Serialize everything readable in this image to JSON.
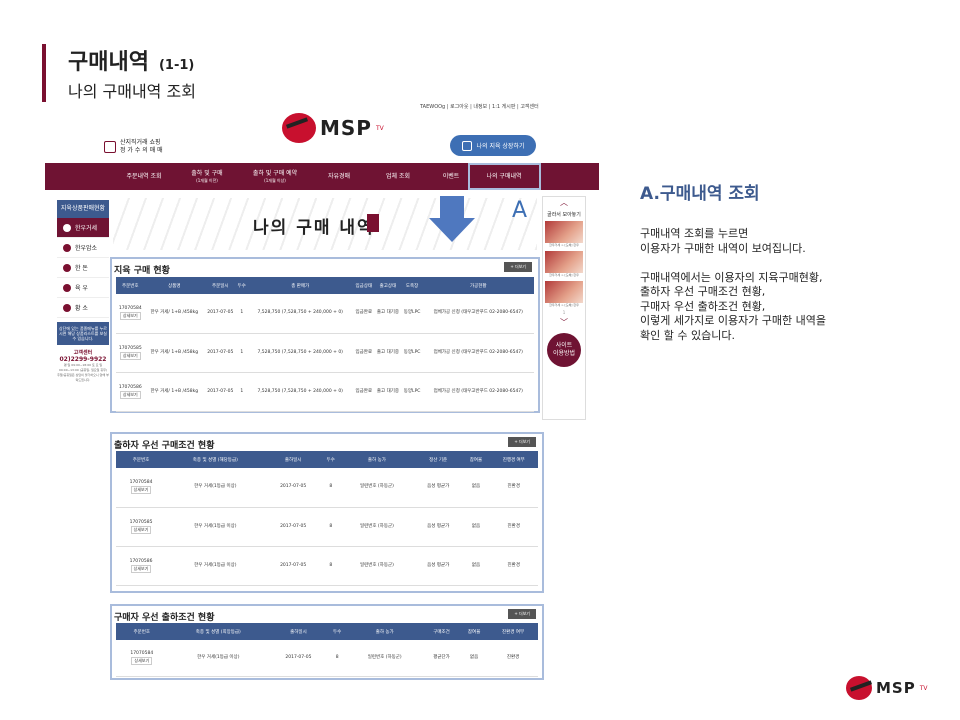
{
  "slide": {
    "title": "구매내역",
    "title_num": "(1-1)",
    "subtitle": "나의 구매내역 조회"
  },
  "site": {
    "util_links": "TAEWOOg | 로그아웃 | 내정보 | 1:1 게시판 | 고객센터",
    "logo_text": "MSP",
    "logo_tv": "TV",
    "cert_line1": "산지직거래 쇼핑",
    "cert_line2": "정 가 수 의 매 매",
    "cart_button": "나의 지육 상장하기",
    "nav": [
      {
        "label": "주문내역 조회",
        "sub": ""
      },
      {
        "label": "출하 및 구매",
        "sub": "(1개월 이전)"
      },
      {
        "label": "출하 및 구매 예약",
        "sub": "(1개월 이상)"
      },
      {
        "label": "자유경매",
        "sub": ""
      },
      {
        "label": "업체 조회",
        "sub": ""
      },
      {
        "label": "이벤트",
        "sub": ""
      },
      {
        "label": "나의 구매내역",
        "sub": ""
      }
    ],
    "banner_title": "나의 구매 내역",
    "marker": "A"
  },
  "left_sidebar": {
    "header": "지육상품판매현황",
    "items": [
      "한우거세",
      "한우암소",
      "한    돈",
      "육    우",
      "황    소"
    ],
    "notice": "상단에 있는 품종메뉴를 누르시면 해당 상품리스트를 보실 수 있습니다.",
    "cs_label": "고객센터",
    "cs_phone": "02)2299-9922",
    "hours": "평 일 09:00~18:00 토 요 일 09:00~13:00 (공휴일, 일요일 휴무)",
    "mini": "주말/공휴일은 상담이 불가하오니 양해 부탁드립니다."
  },
  "right_sidebar": {
    "up": "︿",
    "title": "골라서 모아놓기",
    "items": [
      "한우거세 > [도체] 한우",
      "한우거세 > [도체] 한우",
      "한우거세 > [도체] 한우"
    ],
    "page": "1",
    "down": "﹀",
    "usage": [
      "사이트",
      "이용방법"
    ]
  },
  "tables": {
    "purchase": {
      "title": "지육 구매 현황",
      "more": "+ 더보기",
      "headers": [
        "주문번호",
        "상품명",
        "주문일시",
        "두수",
        "총 판매가",
        "입금상태",
        "출고상태",
        "도축장",
        "가공현황"
      ],
      "rows": [
        [
          "17070584",
          "한우 거세/ 1+B /458kg",
          "2017-07-05",
          "1",
          "7,528,750 (7,528,750 + 240,000 + 0)",
          "입금완료",
          "출고 대기중",
          "동양LPC",
          "업체가공 신청 (태우고반푸드 02-2080-6547)"
        ],
        [
          "17070585",
          "한우 거세/ 1+B /458kg",
          "2017-07-05",
          "1",
          "7,528,750 (7,528,750 + 240,000 + 0)",
          "입금완료",
          "출고 대기중",
          "동양LPC",
          "업체가공 신청 (태우고반푸드 02-2080-6547)"
        ],
        [
          "17070586",
          "한우 거세/ 1+B /458kg",
          "2017-07-05",
          "1",
          "7,528,750 (7,528,750 + 240,000 + 0)",
          "입금완료",
          "출고 대기중",
          "동양LPC",
          "업체가공 신청 (태우고반푸드 02-2080-6547)"
        ]
      ],
      "detail_label": "상세보기"
    },
    "shipper_pref": {
      "title": "출하자 우선 구매조건 현황",
      "more": "+ 더보기",
      "headers": [
        "주문번호",
        "축종 및 성별 (해당등급)",
        "출하일시",
        "두수",
        "출하 농가",
        "정산 기준",
        "참여율",
        "진행경 여부"
      ],
      "rows": [
        [
          "17070584",
          "한우 거세(1등급 이상)",
          "2017-07-05",
          "8",
          "일련번호 (하동군)",
          "음성 평균가",
          "없음",
          "진환경"
        ],
        [
          "17070585",
          "한우 거세(1등급 이상)",
          "2017-07-05",
          "8",
          "일련번호 (하동군)",
          "음성 평균가",
          "없음",
          "진환경"
        ],
        [
          "17070586",
          "한우 거세(1등급 이상)",
          "2017-07-05",
          "8",
          "일련번호 (하동군)",
          "음성 평균가",
          "없음",
          "진환경"
        ]
      ],
      "detail_label": "상세보기"
    },
    "buyer_pref": {
      "title": "구매자 우선 출하조건 현황",
      "more": "+ 더보기",
      "headers": [
        "주문번호",
        "축종 및 성별 (희망등급)",
        "출하일시",
        "두수",
        "출하 농가",
        "구매조건",
        "참여율",
        "진환경 여부"
      ],
      "rows": [
        [
          "17070584",
          "한우 거세(1등급 이상)",
          "2017-07-05",
          "8",
          "일련번호 (하동군)",
          "평균단가",
          "없음",
          "진환경"
        ]
      ],
      "detail_label": "상세보기"
    }
  },
  "description": {
    "title": "A.구매내역 조회",
    "lines": [
      "구매내역 조회를 누르면",
      "이용자가 구매한 내역이 보여집니다.",
      "",
      "구매내역에서는 이용자의 지육구매현황,",
      "출하자 우선 구매조건 현황,",
      "구매자 우선 출하조건 현황,",
      "이렇게 세가지로 이용자가 구매한 내역을",
      "확인 할 수 있습니다."
    ]
  },
  "colors": {
    "brand": "#6f1333",
    "table_header": "#3d5a8e",
    "highlight": "#a9bcdc",
    "accent": "#3d6fb4"
  }
}
